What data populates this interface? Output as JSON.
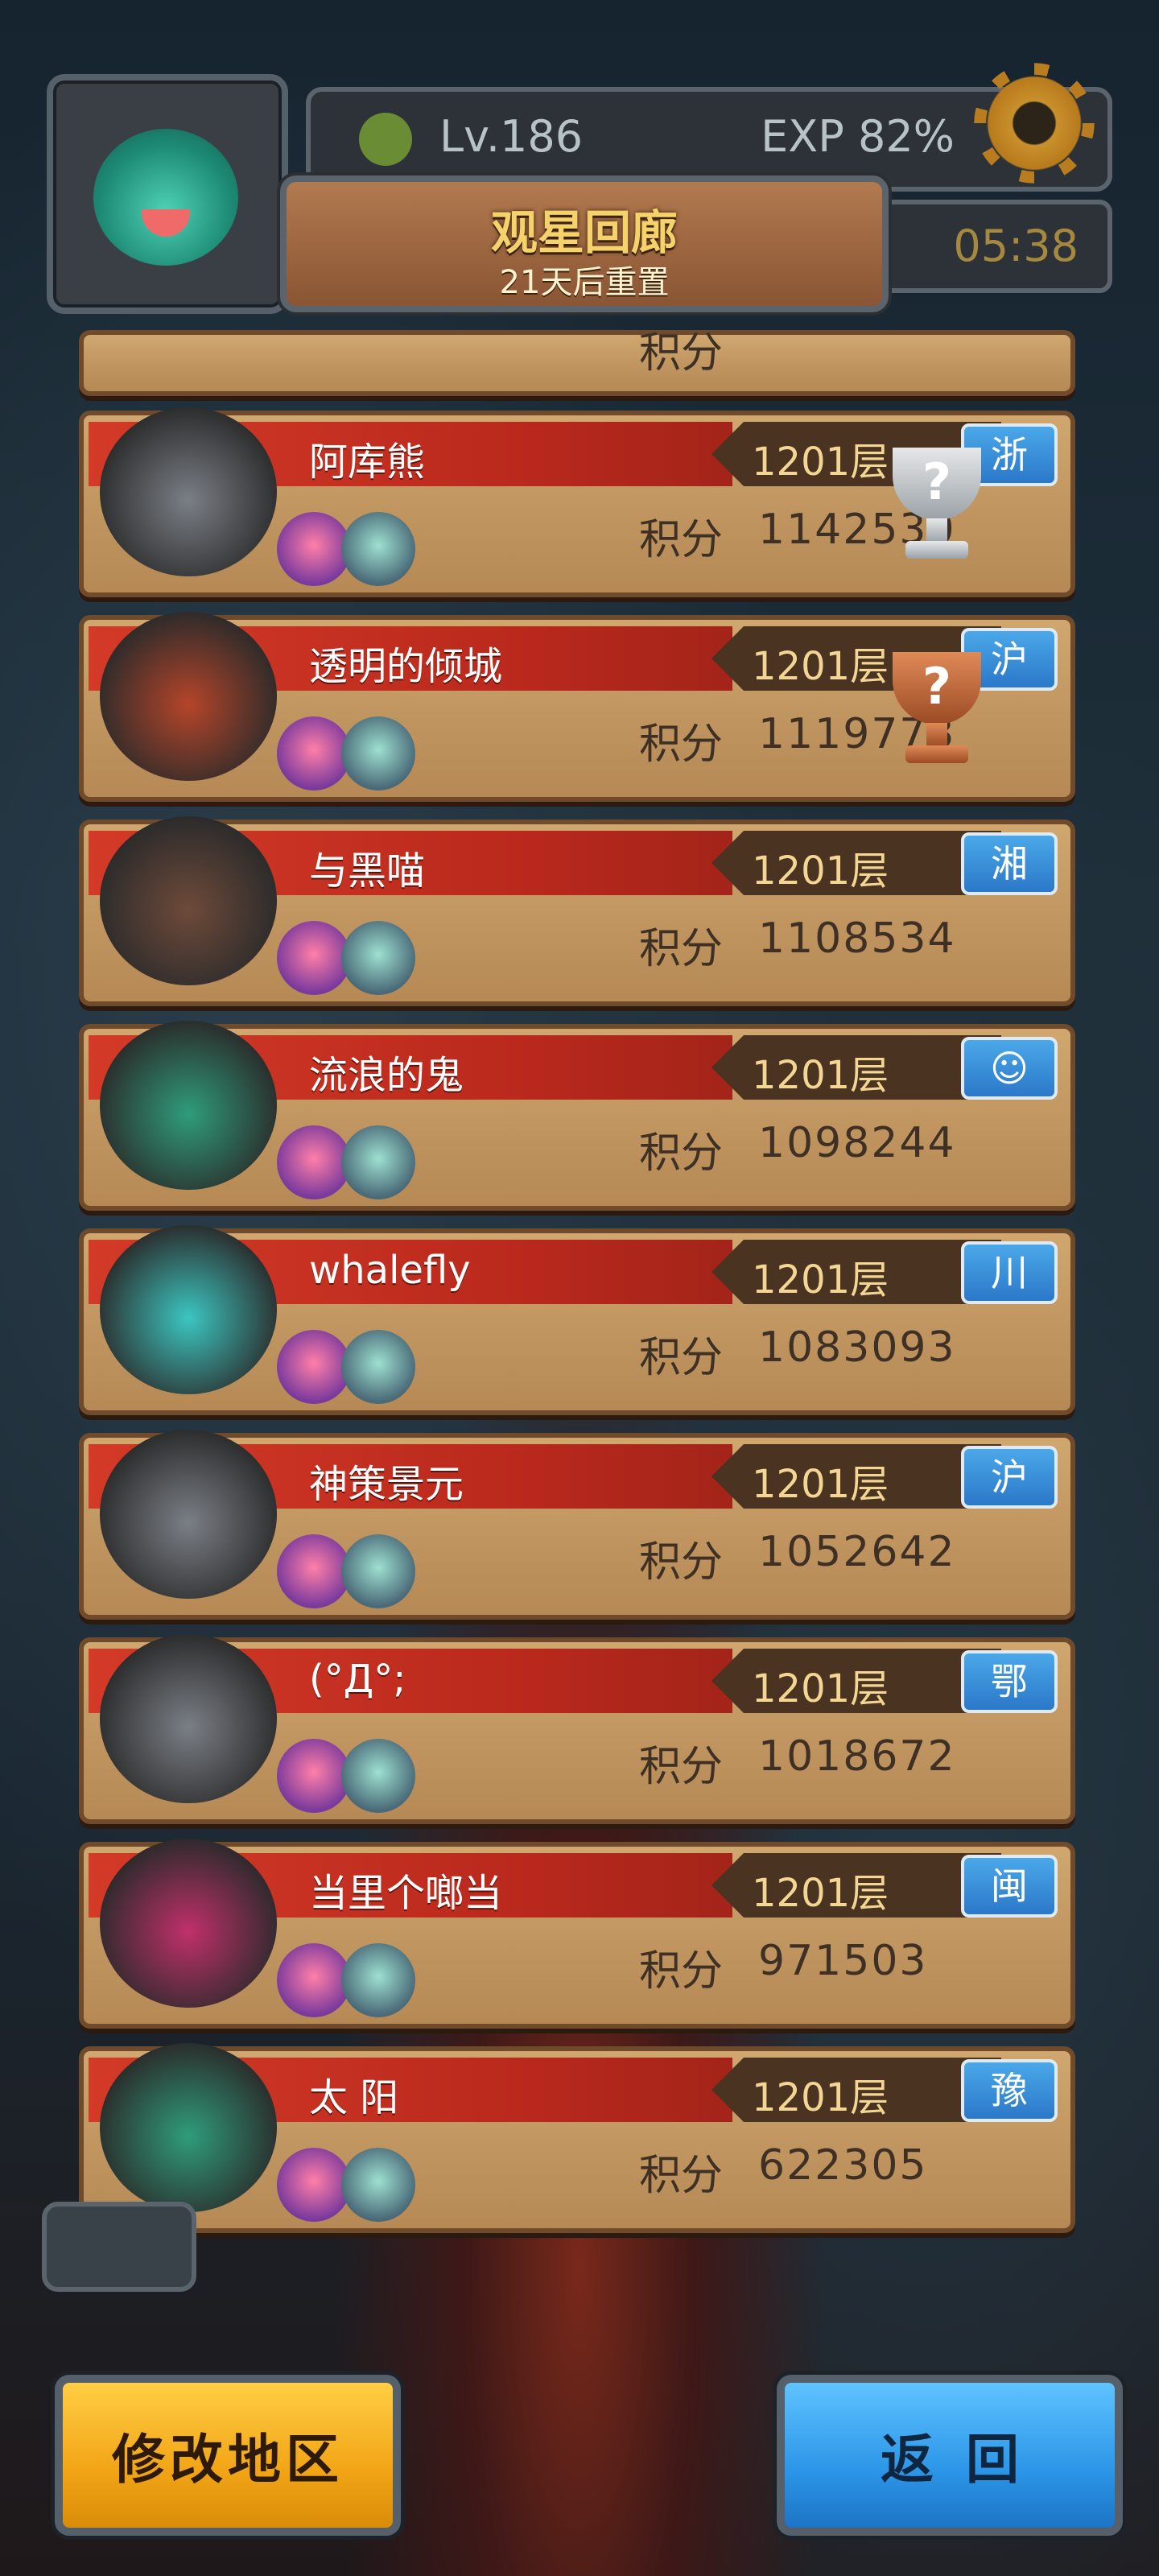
{
  "header": {
    "level": "Lv.186",
    "exp": "EXP 82%",
    "timer": "05:38",
    "title": "观星回廊",
    "subtitle": "21天后重置"
  },
  "partial_row": {
    "score_label": "积分"
  },
  "rows": [
    {
      "name": "阿库熊",
      "floor": "1201层",
      "region": "浙",
      "score_label": "积分",
      "score": "1142530",
      "trophy": "silver",
      "hero_color": "#7a7f86"
    },
    {
      "name": "透明的倾城",
      "floor": "1201层",
      "region": "沪",
      "score_label": "积分",
      "score": "1119773",
      "trophy": "bronze",
      "hero_color": "#b5452a"
    },
    {
      "name": "与黑喵",
      "floor": "1201层",
      "region": "湘",
      "score_label": "积分",
      "score": "1108534",
      "trophy": "",
      "hero_color": "#6e4a3a"
    },
    {
      "name": "流浪的鬼",
      "floor": "1201层",
      "region": "☺",
      "score_label": "积分",
      "score": "1098244",
      "trophy": "",
      "hero_color": "#2f9c7a"
    },
    {
      "name": "whalefly",
      "floor": "1201层",
      "region": "川",
      "score_label": "积分",
      "score": "1083093",
      "trophy": "",
      "hero_color": "#3cc6c0"
    },
    {
      "name": "神策景元",
      "floor": "1201层",
      "region": "沪",
      "score_label": "积分",
      "score": "1052642",
      "trophy": "",
      "hero_color": "#7a7f86"
    },
    {
      "name": "(°Д°;",
      "floor": "1201层",
      "region": "鄂",
      "score_label": "积分",
      "score": "1018672",
      "trophy": "",
      "hero_color": "#7a7f86"
    },
    {
      "name": "当里个啷当",
      "floor": "1201层",
      "region": "闽",
      "score_label": "积分",
      "score": "971503",
      "trophy": "",
      "hero_color": "#c0306a"
    },
    {
      "name": "太 阳",
      "floor": "1201层",
      "region": "豫",
      "score_label": "积分",
      "score": "622305",
      "trophy": "",
      "hero_color": "#2f9c7a"
    }
  ],
  "buttons": {
    "change_region": "修改地区",
    "back": "返回"
  }
}
